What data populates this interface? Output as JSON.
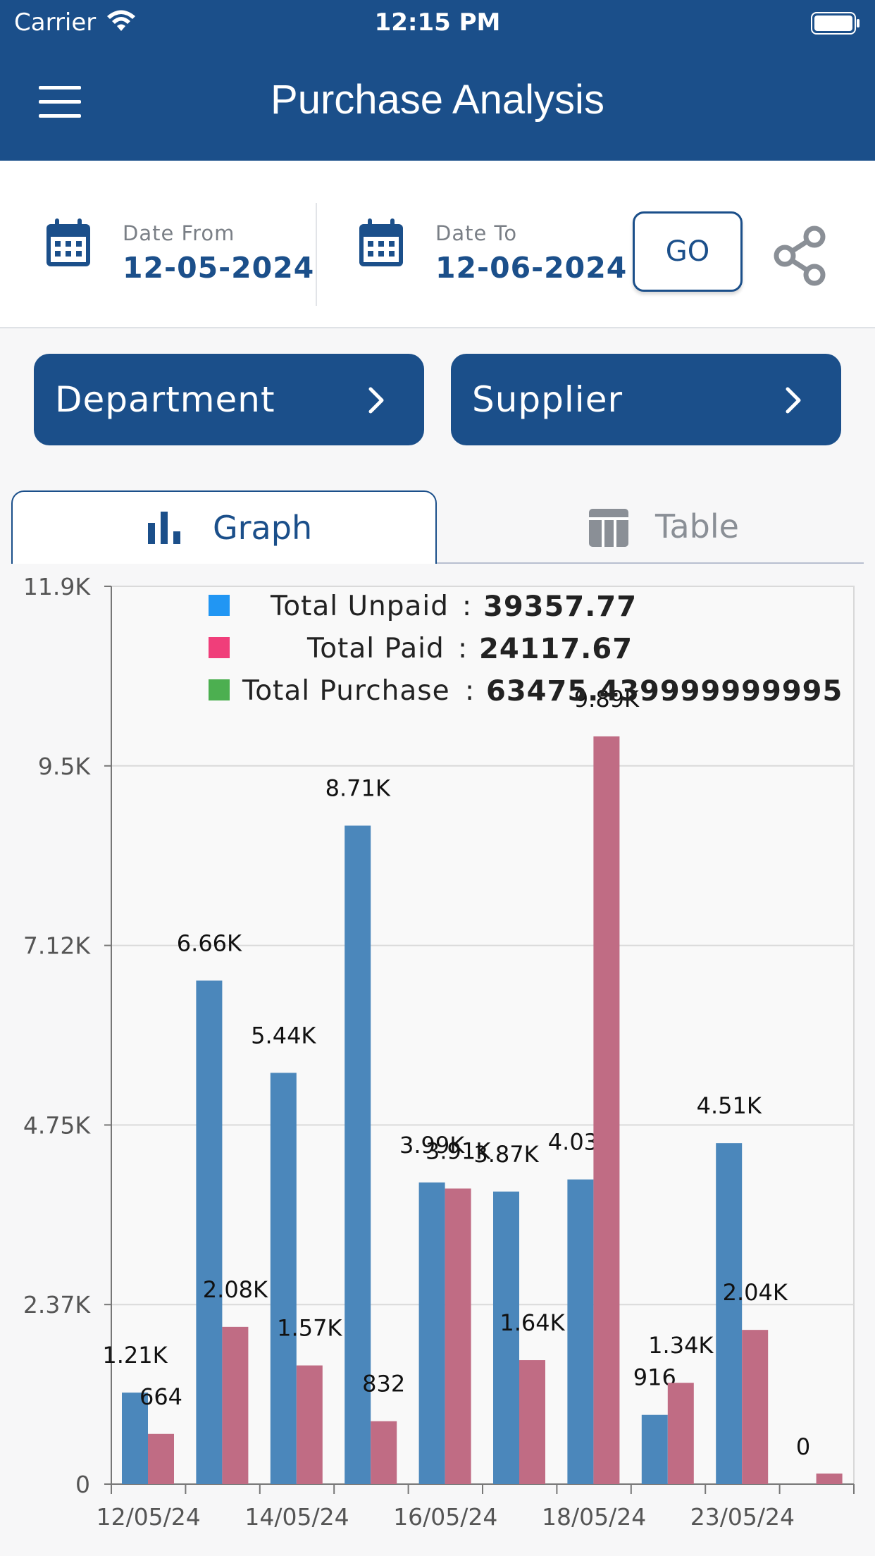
{
  "status_bar": {
    "carrier": "Carrier",
    "time": "12:15 PM"
  },
  "header": {
    "title": "Purchase Analysis"
  },
  "date_from": {
    "label": "Date From",
    "value": "12-05-2024"
  },
  "date_to": {
    "label": "Date To",
    "value": "12-06-2024"
  },
  "go_label": "GO",
  "filters": {
    "department": "Department",
    "supplier": "Supplier"
  },
  "tabs": {
    "graph": "Graph",
    "table": "Table"
  },
  "legend": [
    {
      "label": "Total Unpaid",
      "value": "39357.77",
      "color": "#2196f3"
    },
    {
      "label": "Total Paid",
      "value": "24117.67",
      "color": "#f03e7a"
    },
    {
      "label": "Total Purchase",
      "value": "63475.439999999995",
      "color": "#4caf50"
    }
  ],
  "colors": {
    "primary": "#1b4f8a",
    "unpaid_bar": "#4b87bb",
    "paid_bar": "#c06c84"
  },
  "chart_data": {
    "type": "bar",
    "y_ticks": [
      "0",
      "2.37K",
      "4.75K",
      "7.12K",
      "9.5K",
      "11.9K"
    ],
    "y_tick_values": [
      0,
      2375,
      4750,
      7125,
      9500,
      11875
    ],
    "ylim": [
      0,
      11875
    ],
    "x_tick_labels": [
      "12/05/24",
      "14/05/24",
      "16/05/24",
      "18/05/24",
      "23/05/24"
    ],
    "series": [
      {
        "name": "Total Unpaid",
        "color": "#4b87bb",
        "values": [
          1210,
          6660,
          5440,
          8710,
          3990,
          3870,
          4030,
          916,
          4510,
          0
        ],
        "labels": [
          "1.21K",
          "6.66K",
          "5.44K",
          "8.71K",
          "3.99K",
          "3.87K",
          "4.03K",
          "916",
          "4.51K",
          "0"
        ]
      },
      {
        "name": "Total Paid",
        "color": "#c06c84",
        "values": [
          664,
          2080,
          1570,
          832,
          3910,
          1640,
          9890,
          1340,
          2040,
          140
        ],
        "labels": [
          "664",
          "2.08K",
          "1.57K",
          "832",
          "3.91K",
          "1.64K",
          "9.89K",
          "1.34K",
          "2.04K",
          ""
        ]
      }
    ],
    "grid": true
  }
}
